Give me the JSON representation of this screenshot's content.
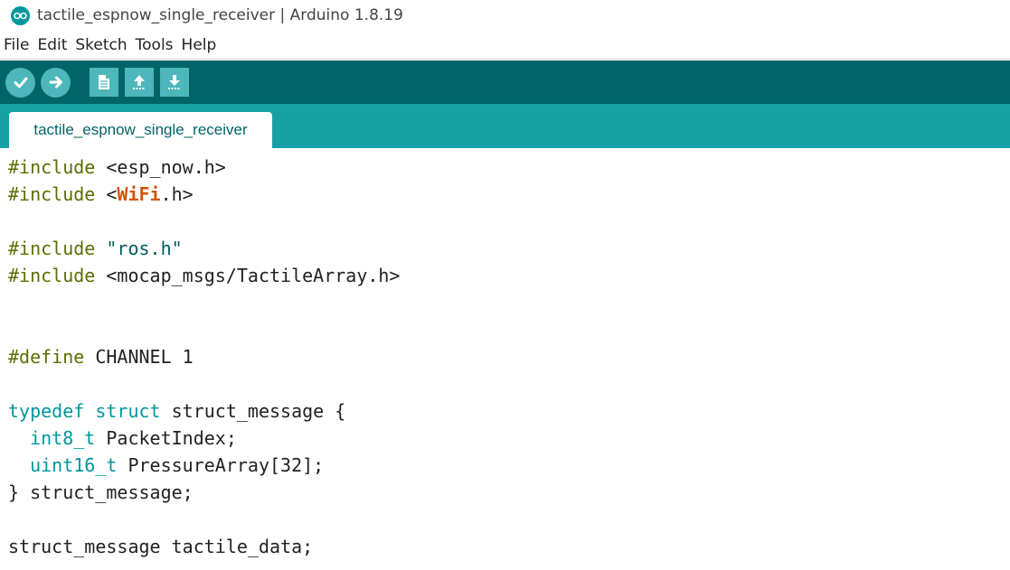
{
  "window": {
    "title": "tactile_espnow_single_receiver | Arduino 1.8.19"
  },
  "menu": {
    "items": [
      "File",
      "Edit",
      "Sketch",
      "Tools",
      "Help"
    ]
  },
  "toolbar": {
    "buttons": [
      "verify-icon",
      "upload-icon",
      "new-icon",
      "open-icon",
      "save-icon"
    ]
  },
  "tabs": [
    {
      "label": "tactile_espnow_single_receiver"
    }
  ],
  "colors": {
    "toolbar": "#006468",
    "tabstrip": "#17a1a5",
    "button": "#4db7bb",
    "preprocessor": "#5e6d03",
    "keyword": "#00979c",
    "library": "#d35400"
  },
  "code": {
    "lines": [
      {
        "t1": "#include",
        "t2": " <esp_now.h>"
      },
      {
        "t1": "#include",
        "t2": " <",
        "t3": "WiFi",
        "t4": ".h>"
      },
      {
        "t1": "#include",
        "t2": " ",
        "t3": "\"ros.h\""
      },
      {
        "t1": "#include",
        "t2": " <mocap_msgs/TactileArray.h>"
      },
      {
        "t1": "#define",
        "t2": " CHANNEL 1"
      },
      {
        "t1": "typedef",
        "t2": " ",
        "t3": "struct",
        "t4": " struct_message {"
      },
      {
        "t1": "  ",
        "t2": "int8_t",
        "t3": " PacketIndex;"
      },
      {
        "t1": "  ",
        "t2": "uint16_t",
        "t3": " PressureArray[32];"
      },
      {
        "t1": "} struct_message;"
      },
      {
        "t1": "struct_message tactile_data;"
      }
    ]
  }
}
